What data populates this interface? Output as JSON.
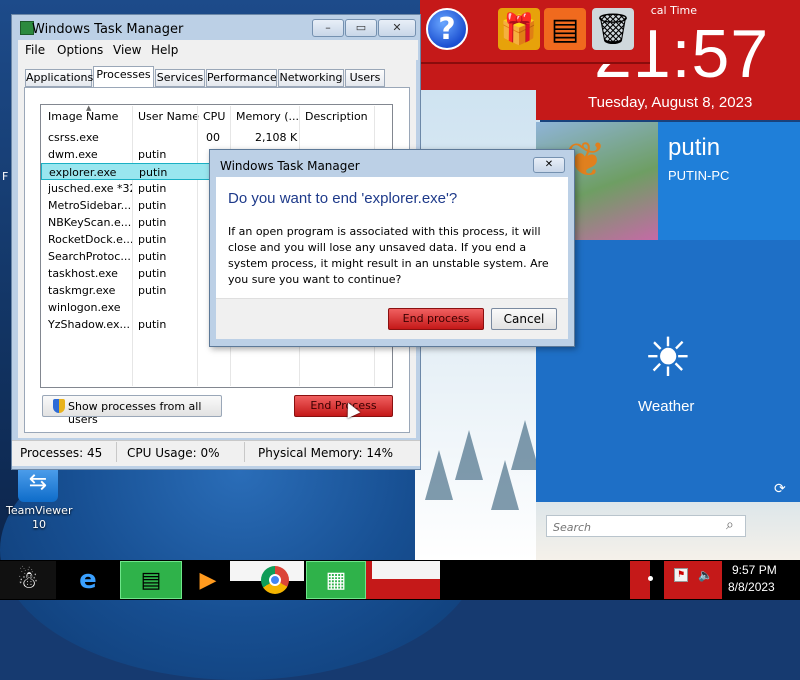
{
  "desktop": {
    "clock_label": "ocal Time",
    "clock_time": "21:57",
    "clock_date": "Tuesday, August 8, 2023",
    "user_name": "putin",
    "user_pc": "PUTIN-PC",
    "weather_label": "Weather",
    "search_placeholder": "Search",
    "teamviewer_label": "TeamViewer 10",
    "f_label": "F"
  },
  "task_manager": {
    "title": "Windows Task Manager",
    "menu": [
      "File",
      "Options",
      "View",
      "Help"
    ],
    "tabs": [
      "Applications",
      "Processes",
      "Services",
      "Performance",
      "Networking",
      "Users"
    ],
    "active_tab": "Processes",
    "columns": [
      "Image Name",
      "User Name",
      "CPU",
      "Memory (...",
      "Description"
    ],
    "rows": [
      {
        "image": "csrss.exe",
        "user": "",
        "cpu": "00",
        "mem": "2,108 K"
      },
      {
        "image": "dwm.exe",
        "user": "putin",
        "cpu": "",
        "mem": ""
      },
      {
        "image": "explorer.exe",
        "user": "putin",
        "cpu": "",
        "mem": ""
      },
      {
        "image": "jusched.exe *32",
        "user": "putin",
        "cpu": "",
        "mem": ""
      },
      {
        "image": "MetroSidebar....",
        "user": "putin",
        "cpu": "",
        "mem": ""
      },
      {
        "image": "NBKeyScan.e...",
        "user": "putin",
        "cpu": "",
        "mem": ""
      },
      {
        "image": "RocketDock.e...",
        "user": "putin",
        "cpu": "",
        "mem": ""
      },
      {
        "image": "SearchProtoc...",
        "user": "putin",
        "cpu": "",
        "mem": ""
      },
      {
        "image": "taskhost.exe",
        "user": "putin",
        "cpu": "",
        "mem": ""
      },
      {
        "image": "taskmgr.exe",
        "user": "putin",
        "cpu": "",
        "mem": ""
      },
      {
        "image": "winlogon.exe",
        "user": "",
        "cpu": "",
        "mem": ""
      },
      {
        "image": "YzShadow.ex...",
        "user": "putin",
        "cpu": "",
        "mem": ""
      }
    ],
    "selected_row": "explorer.exe",
    "show_all_label": "Show processes from all users",
    "end_process_label": "End Process",
    "status": {
      "processes": "Processes: 45",
      "cpu": "CPU Usage: 0%",
      "memory": "Physical Memory: 14%"
    }
  },
  "dialog": {
    "title": "Windows Task Manager",
    "heading": "Do you want to end 'explorer.exe'?",
    "body": "If an open program is associated with this process, it will close and you will lose any unsaved data. If you end a system process, it might result in an unstable system. Are you sure you want to continue?",
    "end_label": "End process",
    "cancel_label": "Cancel"
  },
  "tray": {
    "time": "9:57 PM",
    "date": "8/8/2023"
  }
}
